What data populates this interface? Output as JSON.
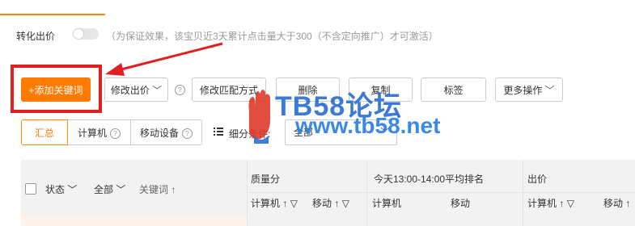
{
  "conversion": {
    "label": "转化出价",
    "hint": "（为保证效果，该宝贝近3天累计点击量大于300（不含定向推广）才可激活）",
    "toggle_on": false
  },
  "toolbar": {
    "add_keyword": "+添加关键词",
    "modify_bid": "修改出价",
    "modify_match": "修改匹配方式",
    "delete": "删除",
    "copy": "复制",
    "tag": "标签",
    "more": "更多操作"
  },
  "segments": [
    "汇总",
    "计算机",
    "移动设备"
  ],
  "filter": {
    "label": "细分条件:",
    "value": "全部"
  },
  "table": {
    "status": "状态",
    "all": "全部",
    "keyword": "关键词",
    "quality": "质量分",
    "rank": "今天13:00-14:00平均排名",
    "bid": "出价",
    "computer": "计算机",
    "mobile": "移动"
  },
  "watermark": {
    "title": "TB58论坛",
    "url": "www.tb58.net"
  },
  "colors": {
    "accent": "#ff7a00",
    "annotation": "#e02020",
    "watermark": "#2b6fd6"
  },
  "icons": [
    "help-icon",
    "chevron-down-icon",
    "sort-arrow-icon",
    "filter-funnel-icon",
    "list-icon",
    "hand-logo-icon"
  ]
}
